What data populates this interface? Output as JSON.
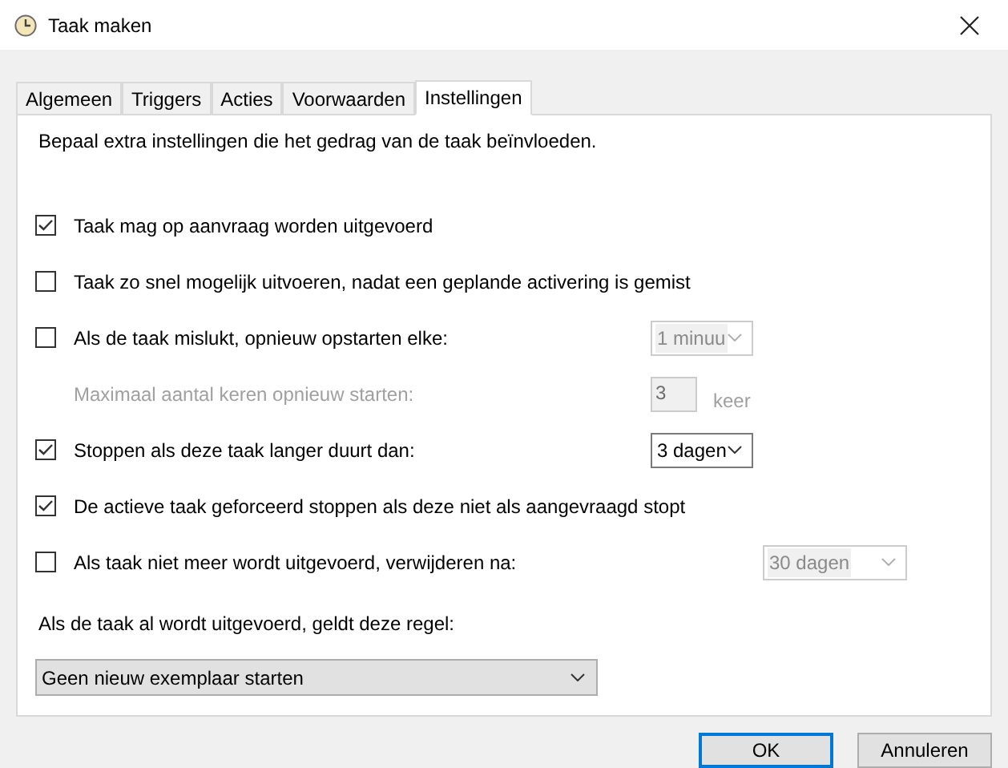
{
  "window": {
    "title": "Taak maken"
  },
  "tabs": [
    {
      "label": "Algemeen",
      "selected": false
    },
    {
      "label": "Triggers",
      "selected": false
    },
    {
      "label": "Acties",
      "selected": false
    },
    {
      "label": "Voorwaarden",
      "selected": false
    },
    {
      "label": "Instellingen",
      "selected": true
    }
  ],
  "description": "Bepaal extra instellingen die het gedrag van de taak beïnvloeden.",
  "rows": [
    {
      "kind": "checkbox",
      "label": "Taak mag op aanvraag worden uitgevoerd",
      "checked": true
    },
    {
      "kind": "checkbox",
      "label": "Taak zo snel mogelijk uitvoeren, nadat een geplande activering is gemist",
      "checked": false
    },
    {
      "kind": "checkbox",
      "label": "Als de taak mislukt, opnieuw opstarten elke:",
      "checked": false,
      "control": {
        "kind": "dropdown",
        "value": "1 minuu",
        "disabled": true
      }
    },
    {
      "kind": "field",
      "label": "Maximaal aantal keren opnieuw starten:",
      "disabled": true,
      "value": "3",
      "unit": "keer"
    },
    {
      "kind": "checkbox",
      "label": "Stoppen als deze taak langer duurt dan:",
      "checked": true,
      "control": {
        "kind": "dropdown",
        "value": "3 dagen",
        "disabled": false
      }
    },
    {
      "kind": "checkbox",
      "label": "De actieve taak geforceerd stoppen als deze niet als aangevraagd stopt",
      "checked": true
    },
    {
      "kind": "checkbox",
      "label": "Als taak niet meer wordt uitgevoerd, verwijderen na:",
      "checked": false,
      "control": {
        "kind": "wide-dropdown",
        "value": "30 dagen",
        "disabled": true
      }
    }
  ],
  "rule": {
    "label": "Als de taak al wordt uitgevoerd, geldt deze regel:",
    "value": "Geen nieuw exemplaar starten"
  },
  "buttons": [
    {
      "label": "OK",
      "kind": "default"
    },
    {
      "label": "Annuleren",
      "kind": "normal"
    }
  ]
}
